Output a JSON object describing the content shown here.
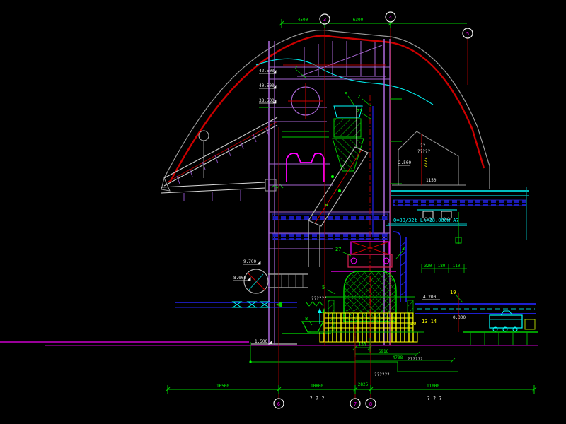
{
  "drawing": {
    "crane": {
      "label": "Q=80/32t  Lk=18.000m  A7"
    },
    "dims": {
      "top": [
        "4500",
        "6300"
      ],
      "bottom": [
        "16500",
        "10800",
        "2825",
        "11000"
      ],
      "foundation": [
        "150",
        "6916",
        "4708"
      ],
      "right": [
        "320",
        "180",
        "110"
      ]
    },
    "elevations": {
      "e1": "42.500",
      "e2": "40.500",
      "e3": "38.500",
      "e4": "9.700",
      "e5": "8.000",
      "e6": "1.500",
      "e7": "4.200",
      "e8": "0.300",
      "e9": "2.500"
    },
    "balloons": {
      "b2": "2",
      "b9": "9",
      "b21": "21",
      "b22": "22",
      "b27": "27",
      "b3": "3",
      "b5": "5",
      "b8": "8",
      "b19": "19",
      "b20": "20",
      "b1314": "13 14"
    },
    "bubbles": {
      "t1": "3",
      "t2": "4",
      "t3": "5",
      "g1": "6",
      "g2": "7",
      "g3": "8"
    },
    "texts": {
      "building_title": "??",
      "building_sub": "?????",
      "building_side": "????",
      "building_dim": "1150",
      "pit_note1": "??????",
      "pit_note2": "??????",
      "pit_note3": "??????",
      "axis_note1": "? ? ?",
      "axis_note2": "? ? ?"
    },
    "colors": {
      "background": "#000000",
      "cyan": "#00ffff",
      "green": "#00ff00",
      "magenta": "#ff00ff",
      "red": "#dd0000",
      "yellow": "#ffff00",
      "blue": "#2222ee",
      "purple": "#a665d2",
      "gray": "#b8b8b8",
      "white": "#ffffff"
    }
  }
}
